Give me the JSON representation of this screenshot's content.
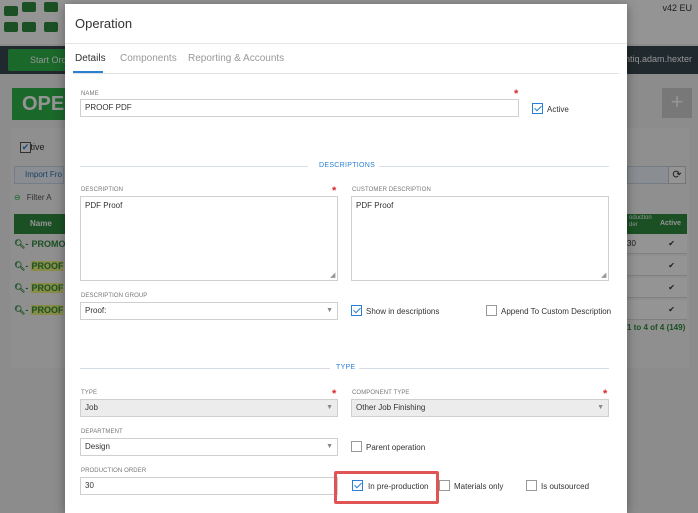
{
  "background": {
    "version": "v42 EU",
    "start_button": "Start Orde",
    "user": "rintiq.adam.hexter",
    "page_title": "OPE",
    "add_button": "+",
    "active_filter": "Active",
    "import_button": "Import Fro",
    "filter_label": "Filter A",
    "table_header_name": "Name",
    "table_header_production_order": "oduction\nder",
    "table_header_active": "Active",
    "rows": [
      {
        "name": "PROMO",
        "value": "30",
        "active": "✔"
      },
      {
        "name": "PROOF",
        "value": "",
        "active": "✔"
      },
      {
        "name": "PROOF",
        "value": "",
        "active": "✔"
      },
      {
        "name": "PROOF",
        "value": "",
        "active": "✔"
      }
    ],
    "paging": "1 to 4 of 4 (149)"
  },
  "modal": {
    "title": "Operation",
    "tabs": [
      "Details",
      "Components",
      "Reporting & Accounts"
    ],
    "name_label": "NAME",
    "name_value": "PROOF PDF",
    "active_label": "Active",
    "active_checked": true,
    "descriptions_section": "DESCRIPTIONS",
    "description_label": "DESCRIPTION",
    "description_value": "PDF Proof",
    "customer_description_label": "CUSTOMER DESCRIPTION",
    "customer_description_value": "PDF Proof",
    "description_group_label": "DESCRIPTION GROUP",
    "description_group_value": "Proof:",
    "show_in_descriptions_label": "Show in descriptions",
    "show_in_descriptions_checked": true,
    "append_custom_label": "Append To Custom Description",
    "append_custom_checked": false,
    "type_section": "TYPE",
    "type_label": "TYPE",
    "type_value": "Job",
    "component_type_label": "COMPONENT TYPE",
    "component_type_value": "Other Job Finishing",
    "department_label": "DEPARTMENT",
    "department_value": "Design",
    "parent_operation_label": "Parent operation",
    "parent_operation_checked": false,
    "production_order_label": "PRODUCTION ORDER",
    "production_order_value": "30",
    "in_preproduction_label": "In pre-production",
    "in_preproduction_checked": true,
    "materials_only_label": "Materials only",
    "materials_only_checked": false,
    "is_outsourced_label": "Is outsourced",
    "is_outsourced_checked": false
  },
  "colors": {
    "accent_blue": "#2a7fd4",
    "brand_green": "#2e8b3d",
    "required_red": "#d9252b",
    "highlight_red": "#e05553"
  }
}
